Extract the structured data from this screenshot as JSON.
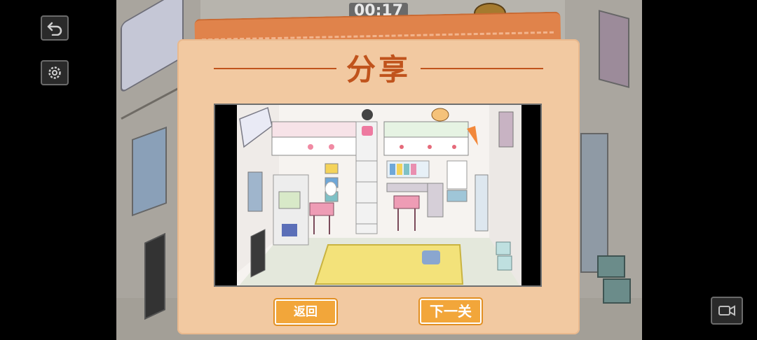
{
  "hud": {
    "timer": "00:17",
    "undo_icon": "undo-arrow-icon",
    "settings_icon": "gear-icon",
    "record_icon": "video-camera-icon"
  },
  "dialog": {
    "title": "分享",
    "back_label": "返回",
    "next_label": "下一关"
  },
  "colors": {
    "dialog_bg": "#f2c9a1",
    "title": "#c0531c",
    "button": "#f2a63a",
    "card_back": "#e0834b"
  }
}
